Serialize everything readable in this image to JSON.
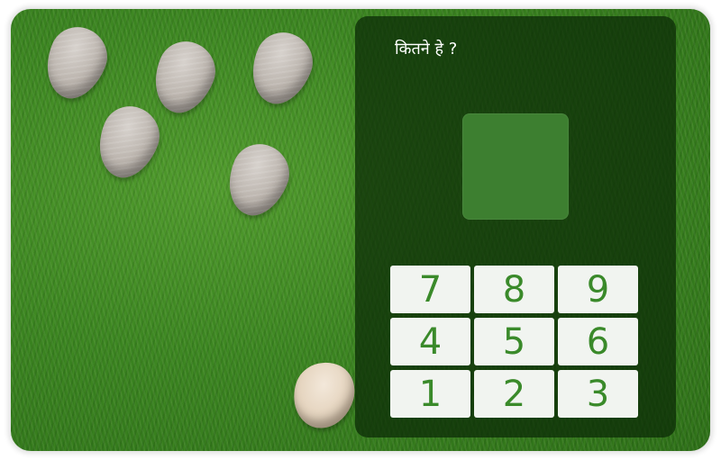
{
  "question": "कितने हे ?",
  "stones": {
    "count": 5
  },
  "keypad": {
    "keys": [
      "7",
      "8",
      "9",
      "4",
      "5",
      "6",
      "1",
      "2",
      "3"
    ]
  },
  "answer": ""
}
